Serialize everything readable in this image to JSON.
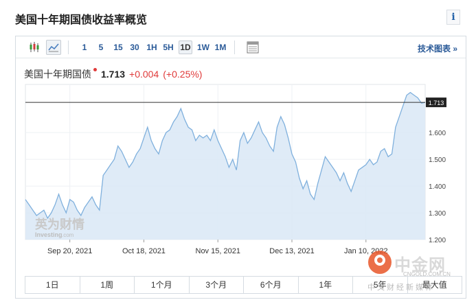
{
  "page": {
    "title": "美国十年期国债收益率概览",
    "info_glyph": "i"
  },
  "toolbar": {
    "timeframes": [
      "1",
      "5",
      "15",
      "30",
      "1H",
      "5H",
      "1D",
      "1W",
      "1M"
    ],
    "active_timeframe": "1D",
    "tech_chart_link": "技术图表 »"
  },
  "quote": {
    "name": "美国十年期国债",
    "last": "1.713",
    "change": "+0.004",
    "change_pct": "(+0.25%)"
  },
  "watermark": {
    "brand": "英为财情",
    "sub": "Investing",
    "sub2": ".com",
    "cn_brand": "中金网",
    "cn_url": "CNGOLD.COM.CN",
    "cn_sub": "中文财经新媒体"
  },
  "range_buttons": [
    "1日",
    "1周",
    "1个月",
    "3个月",
    "6个月",
    "1年",
    "5年",
    "最大值"
  ],
  "colors": {
    "accent": "#2a5a98",
    "line": "#7fb0dd",
    "fill": "#dbe9f6",
    "up": "#e03a3a"
  },
  "chart_data": {
    "type": "area",
    "ylim": [
      1.2,
      1.78
    ],
    "yticks": [
      "1.200",
      "1.300",
      "1.400",
      "1.500",
      "1.600"
    ],
    "xtick_labels": [
      "Sep 20, 2021",
      "Oct 18, 2021",
      "Nov 15, 2021",
      "Dec 13, 2021",
      "Jan 10, 2022"
    ],
    "xtick_index": [
      12,
      32,
      52,
      72,
      92
    ],
    "last_label": "1.713",
    "last_value": 1.713,
    "values": [
      1.35,
      1.33,
      1.31,
      1.29,
      1.3,
      1.31,
      1.28,
      1.3,
      1.33,
      1.37,
      1.33,
      1.3,
      1.35,
      1.34,
      1.31,
      1.29,
      1.32,
      1.34,
      1.36,
      1.33,
      1.31,
      1.44,
      1.46,
      1.48,
      1.5,
      1.55,
      1.53,
      1.5,
      1.47,
      1.49,
      1.52,
      1.54,
      1.58,
      1.62,
      1.57,
      1.54,
      1.52,
      1.57,
      1.6,
      1.61,
      1.64,
      1.66,
      1.69,
      1.65,
      1.62,
      1.61,
      1.57,
      1.59,
      1.58,
      1.59,
      1.57,
      1.61,
      1.57,
      1.54,
      1.51,
      1.47,
      1.5,
      1.46,
      1.57,
      1.6,
      1.56,
      1.58,
      1.61,
      1.64,
      1.6,
      1.58,
      1.55,
      1.53,
      1.62,
      1.66,
      1.63,
      1.58,
      1.52,
      1.49,
      1.43,
      1.39,
      1.42,
      1.37,
      1.35,
      1.41,
      1.46,
      1.51,
      1.49,
      1.47,
      1.45,
      1.42,
      1.45,
      1.41,
      1.38,
      1.42,
      1.46,
      1.47,
      1.48,
      1.5,
      1.48,
      1.49,
      1.53,
      1.54,
      1.51,
      1.52,
      1.62,
      1.66,
      1.7,
      1.74,
      1.75,
      1.74,
      1.73,
      1.71,
      1.713
    ]
  }
}
